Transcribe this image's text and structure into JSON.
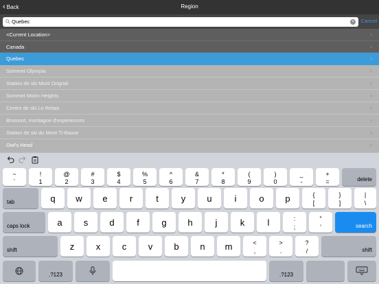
{
  "nav": {
    "back_label": "Back",
    "title": "Region"
  },
  "search": {
    "value": "Quebec",
    "cancel_label": "Cancel"
  },
  "list": {
    "items": [
      {
        "label": "<Current Location>"
      },
      {
        "label": "Canada"
      },
      {
        "label": "Quebec"
      },
      {
        "label": "Sommet Olympia"
      },
      {
        "label": "Station de ski Mont Orignal"
      },
      {
        "label": "Sommet Morin Heights"
      },
      {
        "label": "Centre de ski Le Relais"
      },
      {
        "label": "Bromont, montagne d'experiences"
      },
      {
        "label": "Station de ski du Mont Ti-Basse"
      },
      {
        "label": "Owl's Head"
      }
    ]
  },
  "keyboard": {
    "row1": [
      {
        "top": "~",
        "bot": "`"
      },
      {
        "top": "!",
        "bot": "1"
      },
      {
        "top": "@",
        "bot": "2"
      },
      {
        "top": "#",
        "bot": "3"
      },
      {
        "top": "$",
        "bot": "4"
      },
      {
        "top": "%",
        "bot": "5"
      },
      {
        "top": "^",
        "bot": "6"
      },
      {
        "top": "&",
        "bot": "7"
      },
      {
        "top": "*",
        "bot": "8"
      },
      {
        "top": "(",
        "bot": "9"
      },
      {
        "top": ")",
        "bot": "0"
      },
      {
        "top": "_",
        "bot": "-"
      },
      {
        "top": "+",
        "bot": "="
      }
    ],
    "delete_label": "delete",
    "tab_label": "tab",
    "row2": [
      "q",
      "w",
      "e",
      "r",
      "t",
      "y",
      "u",
      "i",
      "o",
      "p"
    ],
    "row2_extra": [
      {
        "top": "{",
        "bot": "["
      },
      {
        "top": "}",
        "bot": "]"
      },
      {
        "top": "|",
        "bot": "\\"
      }
    ],
    "caps_label": "caps lock",
    "row3": [
      "a",
      "s",
      "d",
      "f",
      "g",
      "h",
      "j",
      "k",
      "l"
    ],
    "row3_extra": [
      {
        "top": ":",
        "bot": ";"
      },
      {
        "top": "”",
        "bot": "’"
      }
    ],
    "search_label": "search",
    "shift_label": "shift",
    "row4": [
      "z",
      "x",
      "c",
      "v",
      "b",
      "n",
      "m"
    ],
    "row4_extra": [
      {
        "top": "<",
        "bot": ","
      },
      {
        "top": ">",
        "bot": "."
      },
      {
        "top": "?",
        "bot": "/"
      }
    ],
    "numbers_label": ".?123",
    "icons": [
      "globe-icon",
      "mic-icon",
      "keyboard-dismiss-icon",
      "undo-icon",
      "redo-icon",
      "paste-icon",
      "search-icon",
      "clear-icon"
    ]
  },
  "colors": {
    "accent": "#3b9cd9",
    "search_key": "#1a8cf0",
    "cancel": "#4a90e2"
  }
}
